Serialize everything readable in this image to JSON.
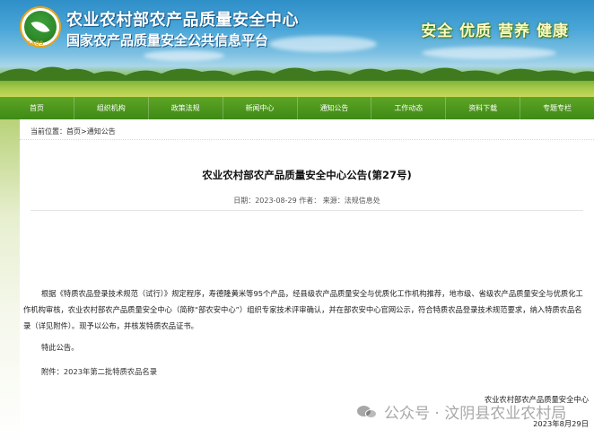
{
  "header": {
    "logo_text": "CAQS",
    "title_main": "农业农村部农产品质量安全中心",
    "title_sub": "国家农产品质量安全公共信息平台",
    "slogan": "安全 优质 营养 健康"
  },
  "nav": {
    "items": [
      "首页",
      "组织机构",
      "政策法规",
      "新闻中心",
      "通知公告",
      "工作动态",
      "资料下载",
      "专题专栏"
    ]
  },
  "breadcrumb": {
    "prefix": "当前位置：",
    "home": "首页",
    "separator": ">",
    "current": "通知公告"
  },
  "article": {
    "title": "农业农村部农产品质量安全中心公告(第27号)",
    "meta": "日期：2023-08-29  作者：  来源：法规信息处",
    "paragraph_1": "根据《特质农品登录技术规范（试行）》规定程序，寿德隆黄米等95个产品，经县级农产品质量安全与优质化工作机构推荐，地市级、省级农产品质量安全与优质化工作机构审核，农业农村部农产品质量安全中心（简称“部农安中心”）组织专家技术评审确认，并在部农安中心官网公示，符合特质农品登录技术规范要求，纳入特质农品名录（详见附件）。现予以公布，并核发特质农品证书。",
    "paragraph_2": "特此公告。",
    "attachment_prefix": "附件：",
    "attachment_link": "2023年第二批特质农品名录",
    "signature_org": "农业农村部农产品质量安全中心",
    "signature_date": "2023年8月29日"
  },
  "watermark": {
    "text": "公众号 · 汶阴县农业农村局"
  },
  "colors": {
    "nav_green": "#3e8a16",
    "banner_blue": "#2f8fc8",
    "slogan_yellow": "#fff7c0"
  }
}
